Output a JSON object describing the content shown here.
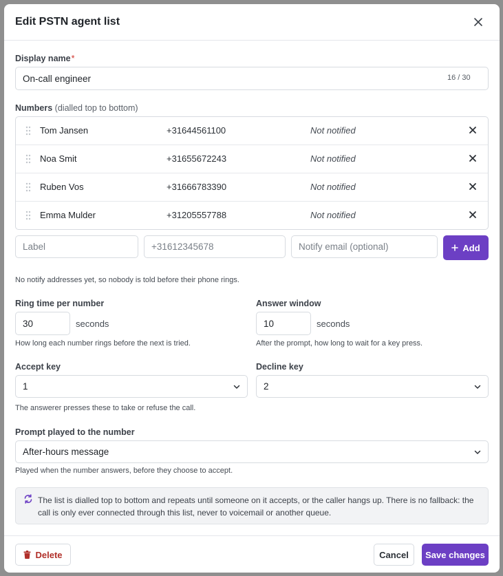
{
  "dialog": {
    "title": "Edit PSTN agent list"
  },
  "display_name": {
    "label": "Display name",
    "required_mark": "*",
    "value": "On-call engineer",
    "counter": "16 / 30"
  },
  "numbers": {
    "label": "Numbers",
    "hint": "(dialled top to bottom)",
    "rows": [
      {
        "name": "Tom Jansen",
        "number": "+31644561100",
        "status": "Not notified"
      },
      {
        "name": "Noa Smit",
        "number": "+31655672243",
        "status": "Not notified"
      },
      {
        "name": "Ruben Vos",
        "number": "+31666783390",
        "status": "Not notified"
      },
      {
        "name": "Emma Mulder",
        "number": "+31205557788",
        "status": "Not notified"
      }
    ],
    "add_label_placeholder": "Label",
    "add_number_placeholder": "+31612345678",
    "add_email_placeholder": "Notify email (optional)",
    "add_button": "Add",
    "notify_note": "No notify addresses yet, so nobody is told before their phone rings."
  },
  "ring_time": {
    "label": "Ring time per number",
    "value": "30",
    "unit": "seconds",
    "help": "How long each number rings before the next is tried."
  },
  "answer_window": {
    "label": "Answer window",
    "value": "10",
    "unit": "seconds",
    "help": "After the prompt, how long to wait for a key press."
  },
  "accept_key": {
    "label": "Accept key",
    "value": "1"
  },
  "decline_key": {
    "label": "Decline key",
    "value": "2"
  },
  "keys_help": "The answerer presses these to take or refuse the call.",
  "prompt": {
    "label": "Prompt played to the number",
    "value": "After-hours message",
    "help": "Played when the number answers, before they choose to accept."
  },
  "info": {
    "text": "The list is dialled top to bottom and repeats until someone on it accepts, or the caller hangs up. There is no fallback: the call is only ever connected through this list, never to voicemail or another queue."
  },
  "footer": {
    "delete": "Delete",
    "cancel": "Cancel",
    "save": "Save changes"
  },
  "colors": {
    "accent": "#6c3fc4",
    "danger": "#b1302a",
    "required": "#d0342c"
  }
}
